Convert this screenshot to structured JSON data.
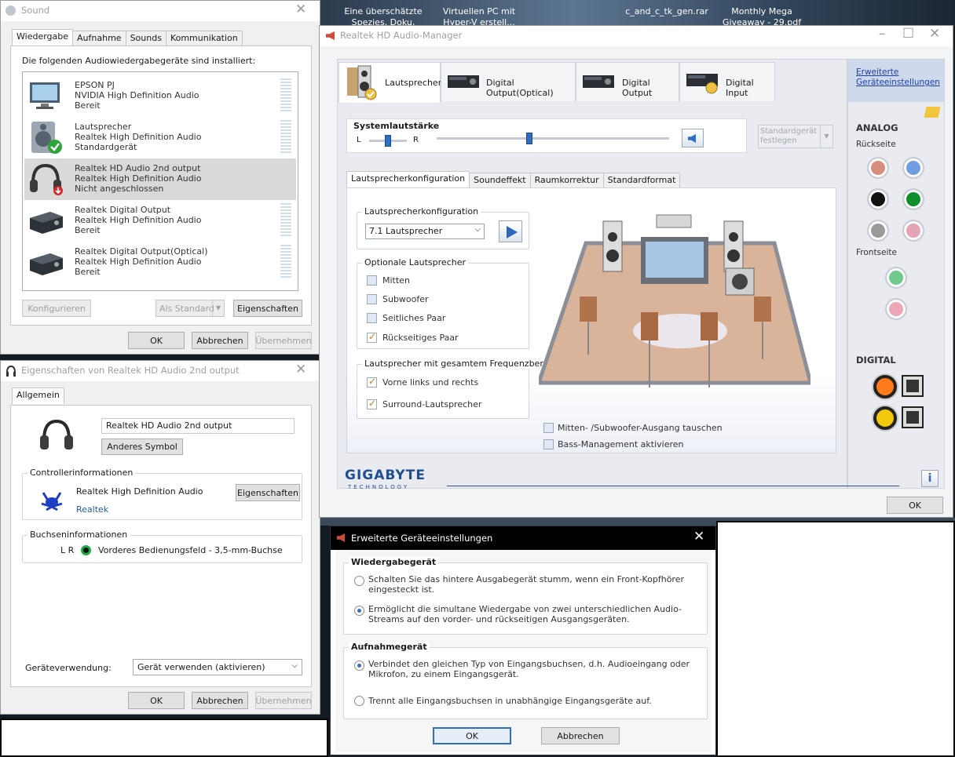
{
  "desktop": {
    "items": [
      {
        "label": "Eine überschätzte Spezies, Doku, ART..."
      },
      {
        "label": "Virtuellen PC mit Hyper-V erstell..."
      },
      {
        "label": "c_and_c_tk_gen.rar"
      },
      {
        "label": "Monthly Mega Giveaway - 29.pdf"
      }
    ]
  },
  "sound": {
    "title": "Sound",
    "tabs": [
      "Wiedergabe",
      "Aufnahme",
      "Sounds",
      "Kommunikation"
    ],
    "heading": "Die folgenden Audiowiedergabegeräte sind installiert:",
    "devices": [
      {
        "name": "EPSON PJ",
        "driver": "NVIDIA High Definition Audio",
        "status": "Bereit"
      },
      {
        "name": "Lautsprecher",
        "driver": "Realtek High Definition Audio",
        "status": "Standardgerät"
      },
      {
        "name": "Realtek HD Audio 2nd output",
        "driver": "Realtek High Definition Audio",
        "status": "Nicht angeschlossen"
      },
      {
        "name": "Realtek Digital Output",
        "driver": "Realtek High Definition Audio",
        "status": "Bereit"
      },
      {
        "name": "Realtek Digital Output(Optical)",
        "driver": "Realtek High Definition Audio",
        "status": "Bereit"
      }
    ],
    "btn_configure": "Konfigurieren",
    "btn_default": "Als Standard",
    "btn_properties": "Eigenschaften",
    "ok": "OK",
    "cancel": "Abbrechen",
    "apply": "Übernehmen"
  },
  "props": {
    "title": "Eigenschaften von Realtek HD Audio 2nd output",
    "tab": "Allgemein",
    "device_name": "Realtek HD Audio 2nd output",
    "change_icon": "Anderes Symbol",
    "controller_label": "Controllerinformationen",
    "controller_name": "Realtek High Definition Audio",
    "controller_vendor": "Realtek",
    "controller_btn": "Eigenschaften",
    "jack_label": "Buchseninformationen",
    "jack_channels": "L R",
    "jack_desc": "Vorderes Bedienungsfeld - 3,5-mm-Buchse",
    "usage_label": "Geräteverwendung:",
    "usage_value": "Gerät verwenden (aktivieren)",
    "ok": "OK",
    "cancel": "Abbrechen",
    "apply": "Übernehmen"
  },
  "realtek": {
    "title": "Realtek HD Audio-Manager",
    "tabs": [
      "Lautsprecher",
      "Digital Output(Optical)",
      "Digital Output",
      "Digital Input"
    ],
    "advanced_link": "Erweiterte Geräteeinstellungen",
    "system_volume": "Systemlautstärke",
    "balance_l": "L",
    "balance_r": "R",
    "balance_level": 0.5,
    "volume_level": 0.4,
    "set_default": "Standardgerät festlegen",
    "subtabs": [
      "Lautsprecherkonfiguration",
      "Soundeffekt",
      "Raumkorrektur",
      "Standardformat"
    ],
    "config_group": "Lautsprecherkonfiguration",
    "config_value": "7.1 Lautsprecher",
    "optional_group": "Optionale Lautsprecher",
    "optional": [
      {
        "label": "Mitten",
        "checked": false
      },
      {
        "label": "Subwoofer",
        "checked": false
      },
      {
        "label": "Seitliches Paar",
        "checked": false
      },
      {
        "label": "Rückseitiges Paar",
        "checked": true
      }
    ],
    "fullrange_group": "Lautsprecher mit gesamtem Frequenzbereich",
    "fullrange": [
      {
        "label": "Vorne links und rechts",
        "checked": true
      },
      {
        "label": "Surround-Lautsprecher",
        "checked": true
      }
    ],
    "swap": "Mitten- /Subwoofer-Ausgang tauschen",
    "bass": "Bass-Management aktivieren",
    "analog": "ANALOG",
    "rear": "Rückseite",
    "front": "Frontseite",
    "digital": "DIGITAL",
    "jack_colors": {
      "rear": [
        "#d88e7c",
        "#6f9fe0",
        "#111111",
        "#0f8f2a",
        "#9a9a9a",
        "#e3a4b6"
      ],
      "front": [
        "#6fcb8c",
        "#e9a7b8"
      ]
    },
    "brand": "GIGABYTE",
    "brand_sub": "TECHNOLOGY",
    "ok": "OK"
  },
  "advanced": {
    "title": "Erweiterte Geräteeinstellungen",
    "playback_group": "Wiedergabegerät",
    "playback": [
      {
        "label": "Schalten Sie das hintere Ausgabegerät stumm, wenn ein Front-Kopfhörer eingesteckt ist.",
        "selected": false
      },
      {
        "label": "Ermöglicht die simultane Wiedergabe von zwei unterschiedlichen Audio-Streams auf den vorder- und rückseitigen Ausgangsgeräten.",
        "selected": true
      }
    ],
    "recording_group": "Aufnahmegerät",
    "recording": [
      {
        "label": "Verbindet den gleichen Typ von Eingangsbuchsen, d.h. Audioeingang oder Mikrofon, zu einem Eingangsgerät.",
        "selected": true
      },
      {
        "label": "Trennt alle Eingangsbuchsen in unabhängige Eingangsgeräte auf.",
        "selected": false
      }
    ],
    "ok": "OK",
    "cancel": "Abbrechen"
  }
}
